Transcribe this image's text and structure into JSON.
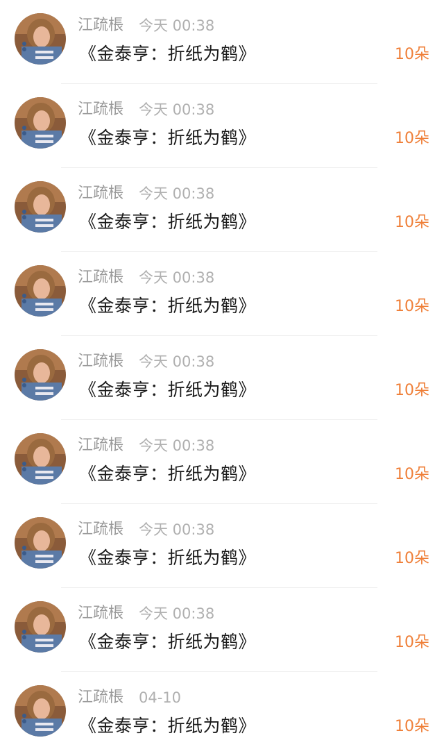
{
  "colors": {
    "username": "#9a9a9a",
    "time": "#b0b0b0",
    "title": "#1c1c1c",
    "gift": "#ef7f38",
    "divider": "#eeeeee"
  },
  "items": [
    {
      "avatar_icon": "user-avatar-photo",
      "username": "江疏棖",
      "time": "今天 00:38",
      "title": "《金泰亨：折纸为鹤》",
      "gift": "10朵"
    },
    {
      "avatar_icon": "user-avatar-photo",
      "username": "江疏棖",
      "time": "今天 00:38",
      "title": "《金泰亨：折纸为鹤》",
      "gift": "10朵"
    },
    {
      "avatar_icon": "user-avatar-photo",
      "username": "江疏棖",
      "time": "今天 00:38",
      "title": "《金泰亨：折纸为鹤》",
      "gift": "10朵"
    },
    {
      "avatar_icon": "user-avatar-photo",
      "username": "江疏棖",
      "time": "今天 00:38",
      "title": "《金泰亨：折纸为鹤》",
      "gift": "10朵"
    },
    {
      "avatar_icon": "user-avatar-photo",
      "username": "江疏棖",
      "time": "今天 00:38",
      "title": "《金泰亨：折纸为鹤》",
      "gift": "10朵"
    },
    {
      "avatar_icon": "user-avatar-photo",
      "username": "江疏棖",
      "time": "今天 00:38",
      "title": "《金泰亨：折纸为鹤》",
      "gift": "10朵"
    },
    {
      "avatar_icon": "user-avatar-photo",
      "username": "江疏棖",
      "time": "今天 00:38",
      "title": "《金泰亨：折纸为鹤》",
      "gift": "10朵"
    },
    {
      "avatar_icon": "user-avatar-photo",
      "username": "江疏棖",
      "time": "今天 00:38",
      "title": "《金泰亨：折纸为鹤》",
      "gift": "10朵"
    },
    {
      "avatar_icon": "user-avatar-photo",
      "username": "江疏棖",
      "time": "04-10",
      "title": "《金泰亨：折纸为鹤》",
      "gift": "10朵"
    }
  ]
}
